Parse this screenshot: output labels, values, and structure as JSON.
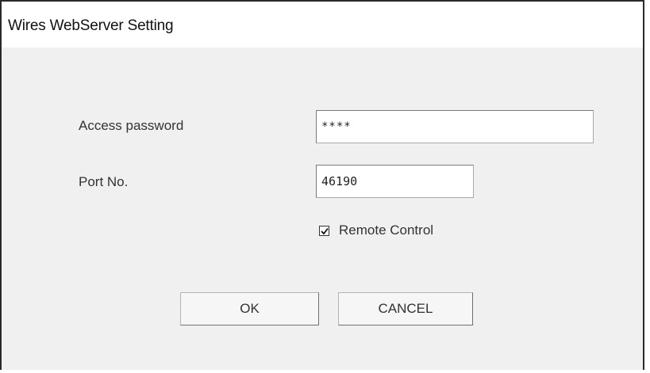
{
  "window": {
    "title": "Wires WebServer Setting"
  },
  "form": {
    "password_label": "Access password",
    "password_value": "****",
    "port_label": "Port No.",
    "port_value": "46190",
    "remote_control_label": "Remote Control",
    "remote_control_checked": true
  },
  "buttons": {
    "ok_label": "OK",
    "cancel_label": "CANCEL"
  }
}
